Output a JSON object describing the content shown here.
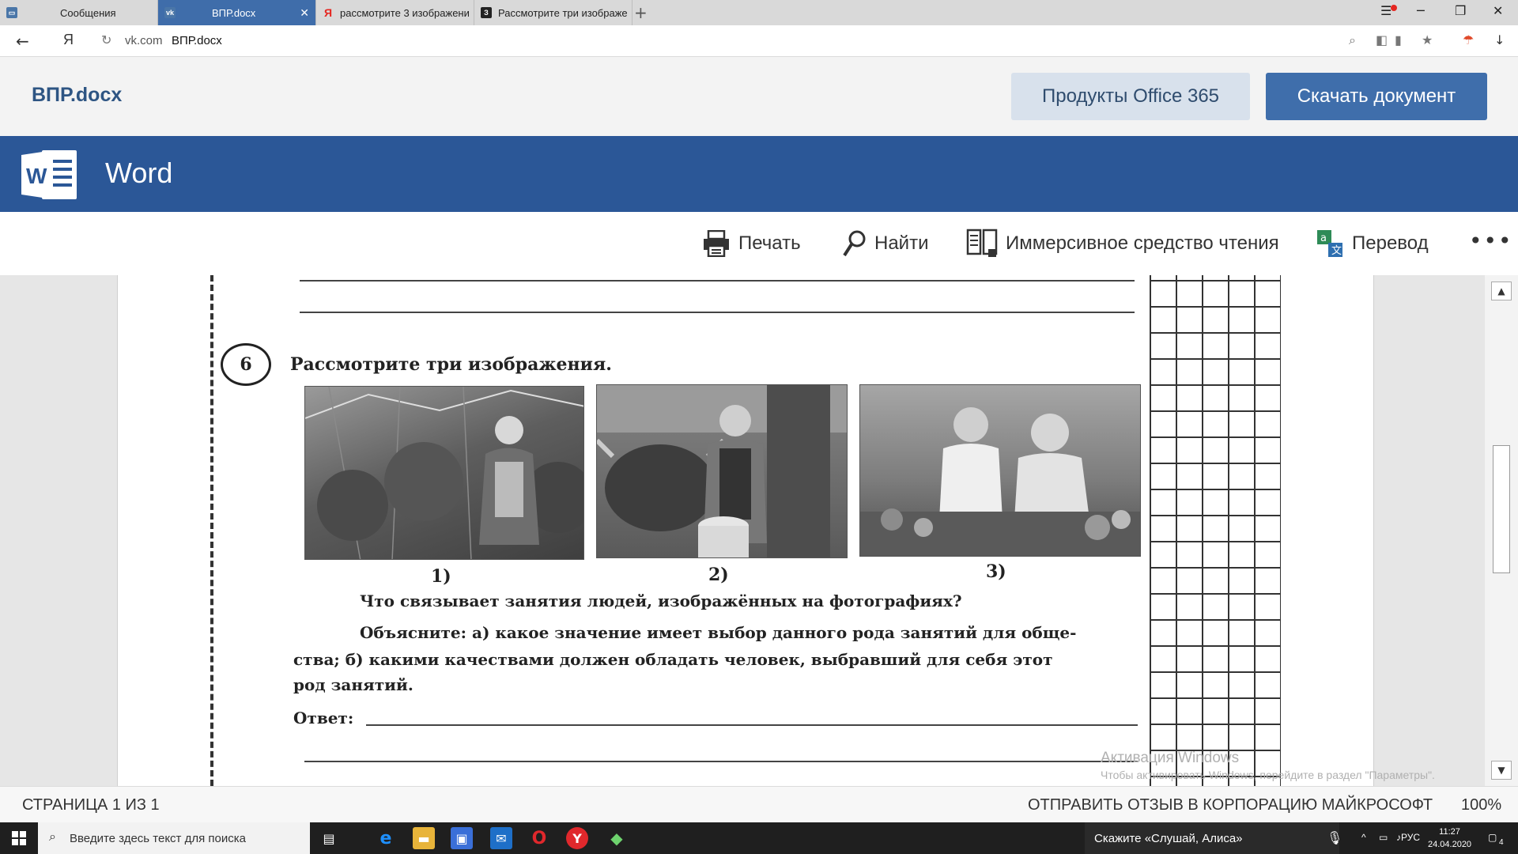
{
  "browser": {
    "tabs": [
      {
        "label": "Сообщения",
        "favicon": "messages-icon",
        "color": "#4a76a8"
      },
      {
        "label": "ВПР.docx",
        "favicon": "vk-icon",
        "color": "#4a76a8",
        "close": "✕"
      },
      {
        "label": "рассмотрите 3 изображени",
        "favicon": "yandex-icon",
        "color": "#e52620"
      },
      {
        "label": "Рассмотрите три изображе",
        "favicon": "z-icon",
        "color": "#222222"
      }
    ],
    "new_tab": "+",
    "address": {
      "domain": "vk.com",
      "title": "ВПР.docx"
    }
  },
  "office_header": {
    "doc_title": "ВПР.docx",
    "products_button": "Продукты Office 365",
    "download_button": "Скачать документ"
  },
  "word_band": {
    "app_name": "Word",
    "brand_color": "#2b5797"
  },
  "toolbar": {
    "print": "Печать",
    "find": "Найти",
    "immersive_reader": "Иммерсивное средство чтения",
    "translate": "Перевод",
    "more": "•••"
  },
  "document": {
    "question_number": "6",
    "heading": "Рассмотрите три изображения.",
    "photo_labels": [
      "1)",
      "2)",
      "3)"
    ],
    "question": "Что связывает занятия людей, изображённых на фотографиях?",
    "explain_line1": "Объясните: а) какое значение имеет выбор данного рода занятий для обще-",
    "explain_line2": "ства; б) какими качествами должен обладать человек, выбравший для себя этот",
    "explain_line3": "род занятий.",
    "answer_label": "Ответ:"
  },
  "watermark": {
    "line1": "Активация Windows",
    "line2": "Чтобы активировать Windows, перейдите в раздел \"Параметры\"."
  },
  "statusbar": {
    "page": "СТРАНИЦА 1 ИЗ 1",
    "feedback": "ОТПРАВИТЬ ОТЗЫВ В КОРПОРАЦИЮ МАЙКРОСОФТ",
    "zoom": "100%"
  },
  "taskbar": {
    "search_placeholder": "Введите здесь текст для поиска",
    "alice_prompt": "Скажите «Слушай, Алиса»",
    "language": "РУС",
    "time": "11:27",
    "date": "24.04.2020",
    "notifications": "4"
  }
}
